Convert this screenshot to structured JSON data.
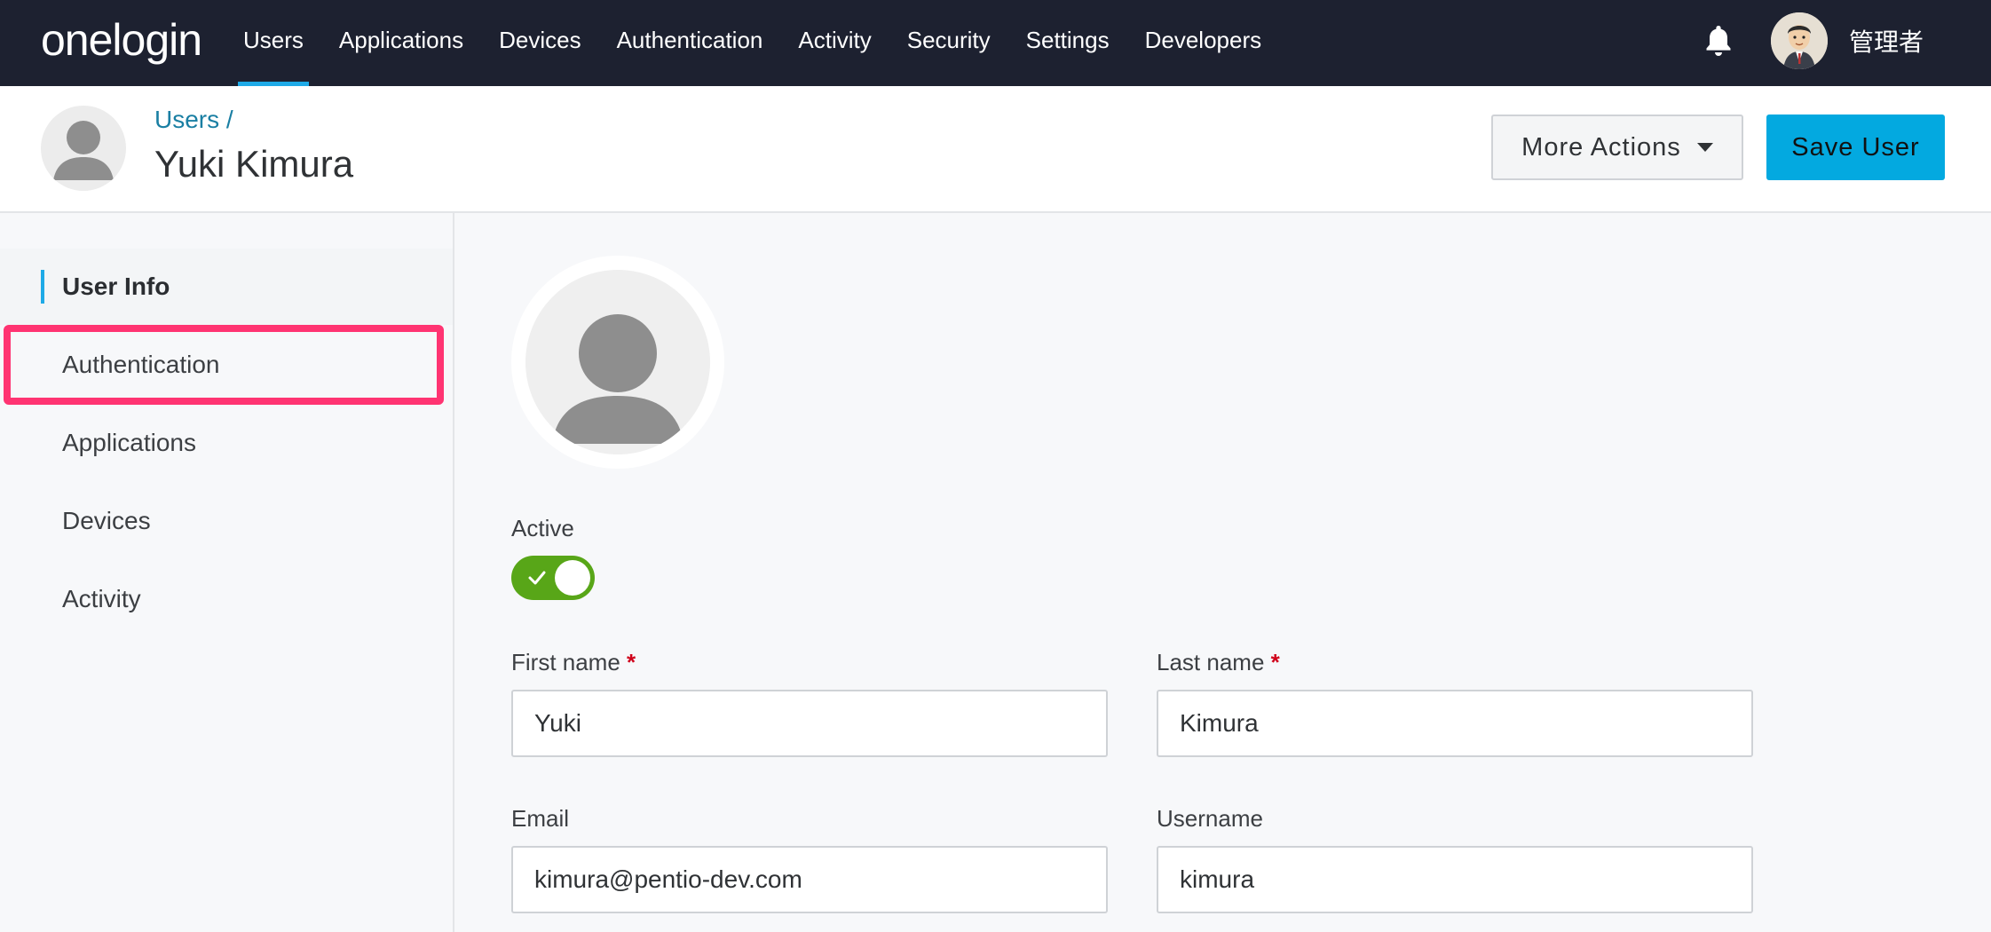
{
  "app": {
    "logo": "onelogin",
    "nav": [
      "Users",
      "Applications",
      "Devices",
      "Authentication",
      "Activity",
      "Security",
      "Settings",
      "Developers"
    ],
    "active_nav": "Users",
    "admin_name": "管理者"
  },
  "header": {
    "breadcrumb": "Users /",
    "title": "Yuki Kimura",
    "more_actions_label": "More Actions",
    "save_label": "Save User"
  },
  "sidebar": {
    "items": [
      "User Info",
      "Authentication",
      "Applications",
      "Devices",
      "Activity"
    ],
    "active_item": "User Info",
    "highlighted_item": "Authentication",
    "highlight_color": "#ff3472"
  },
  "form": {
    "active_label": "Active",
    "active_on": true,
    "first_name_label": "First name",
    "first_name_value": "Yuki",
    "last_name_label": "Last name",
    "last_name_value": "Kimura",
    "email_label": "Email",
    "email_value": "kimura@pentio-dev.com",
    "username_label": "Username",
    "username_value": "kimura",
    "required_marker": "*"
  },
  "colors": {
    "topbar": "#1d2130",
    "accent": "#1eaae7",
    "save_button": "#03a9e0",
    "toggle_on": "#58a618"
  },
  "icons": {
    "bell": "bell-icon",
    "user_placeholder": "user-placeholder-icon",
    "dropdown": "caret-down-icon",
    "check": "check-icon"
  }
}
